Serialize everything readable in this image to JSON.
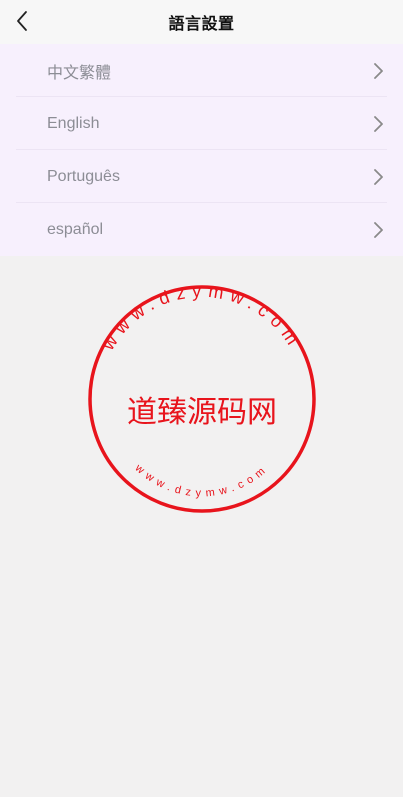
{
  "header": {
    "title": "語言設置",
    "back_icon": "chevron-left-icon"
  },
  "languages": [
    {
      "label": "中文繁體"
    },
    {
      "label": "English"
    },
    {
      "label": "Português"
    },
    {
      "label": "español"
    }
  ],
  "watermark": {
    "center_text": "道臻源码网",
    "outer_text": "www.dzymw.com",
    "inner_text": "www.dzymw.com",
    "color": "#e8141c"
  }
}
